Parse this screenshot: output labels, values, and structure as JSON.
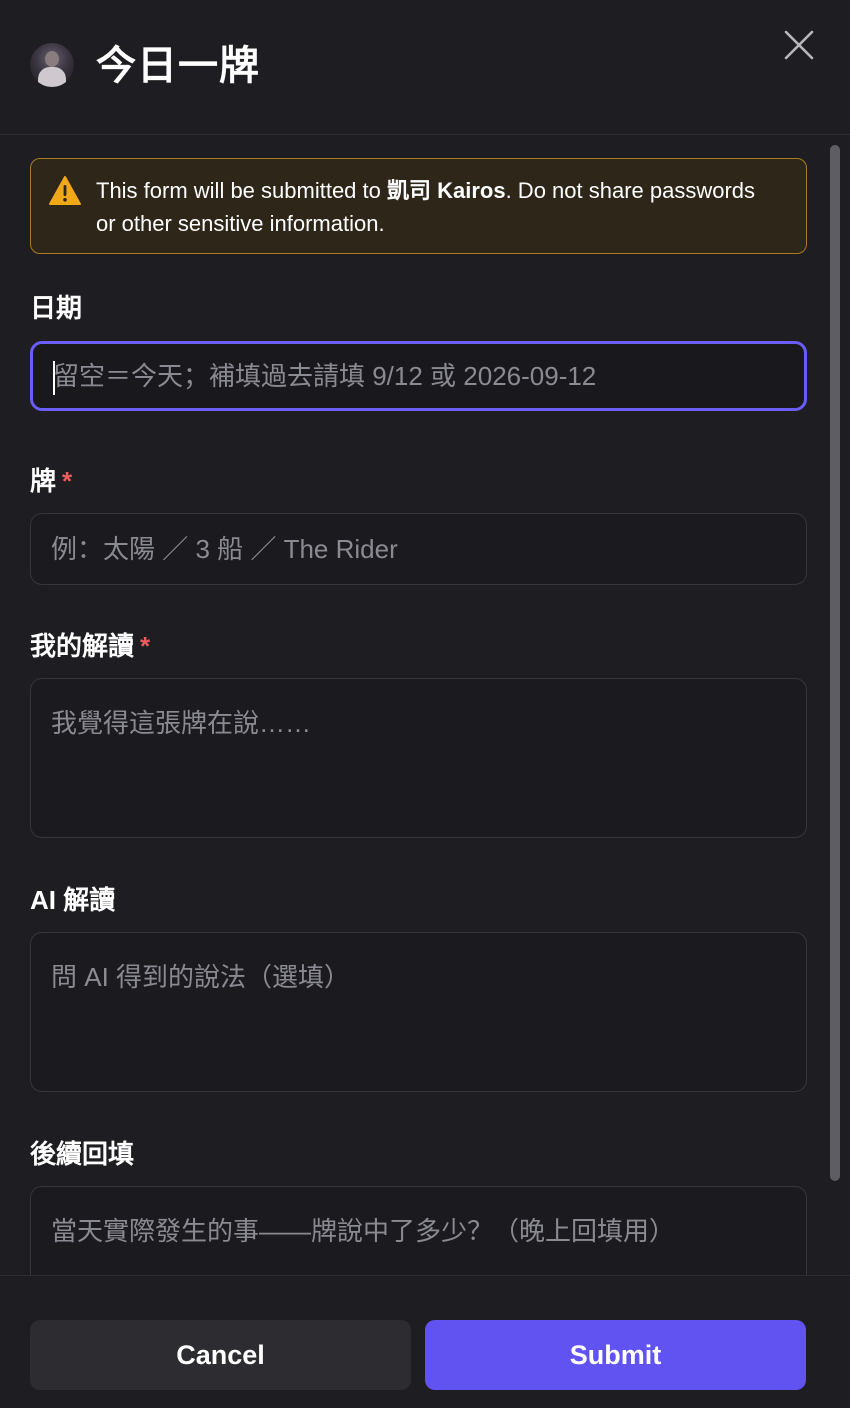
{
  "modal": {
    "title": "今日一牌",
    "close_icon": "close-icon"
  },
  "warning": {
    "icon": "warning-icon",
    "text_before": "This form will be submitted to ",
    "app_name": "凱司 Kairos",
    "text_after": ". Do not share passwords or other sensitive information.",
    "colors": {
      "border": "#a87b24",
      "background": "#2e2619",
      "icon": "#f0a818"
    }
  },
  "fields": {
    "date": {
      "label": "日期",
      "placeholder": "留空＝今天；補填過去請填 9/12 或 2026-09-12",
      "value": ""
    },
    "card": {
      "label": "牌",
      "required_mark": "*",
      "placeholder": "例：太陽 ／ 3 船 ／ The Rider",
      "value": ""
    },
    "my_reading": {
      "label": "我的解讀",
      "required_mark": "*",
      "placeholder": "我覺得這張牌在說……",
      "value": ""
    },
    "ai_reading": {
      "label": "AI 解讀",
      "placeholder": "問 AI 得到的說法（選填）",
      "value": ""
    },
    "follow_up": {
      "label": "後續回填",
      "placeholder": "當天實際發生的事——牌說中了多少？（晚上回填用）",
      "value": ""
    }
  },
  "footer": {
    "cancel_label": "Cancel",
    "submit_label": "Submit"
  },
  "colors": {
    "accent": "#6152f2",
    "focus_border": "#6a5cf6",
    "required": "#ee5c5c",
    "background": "#1e1e22"
  }
}
